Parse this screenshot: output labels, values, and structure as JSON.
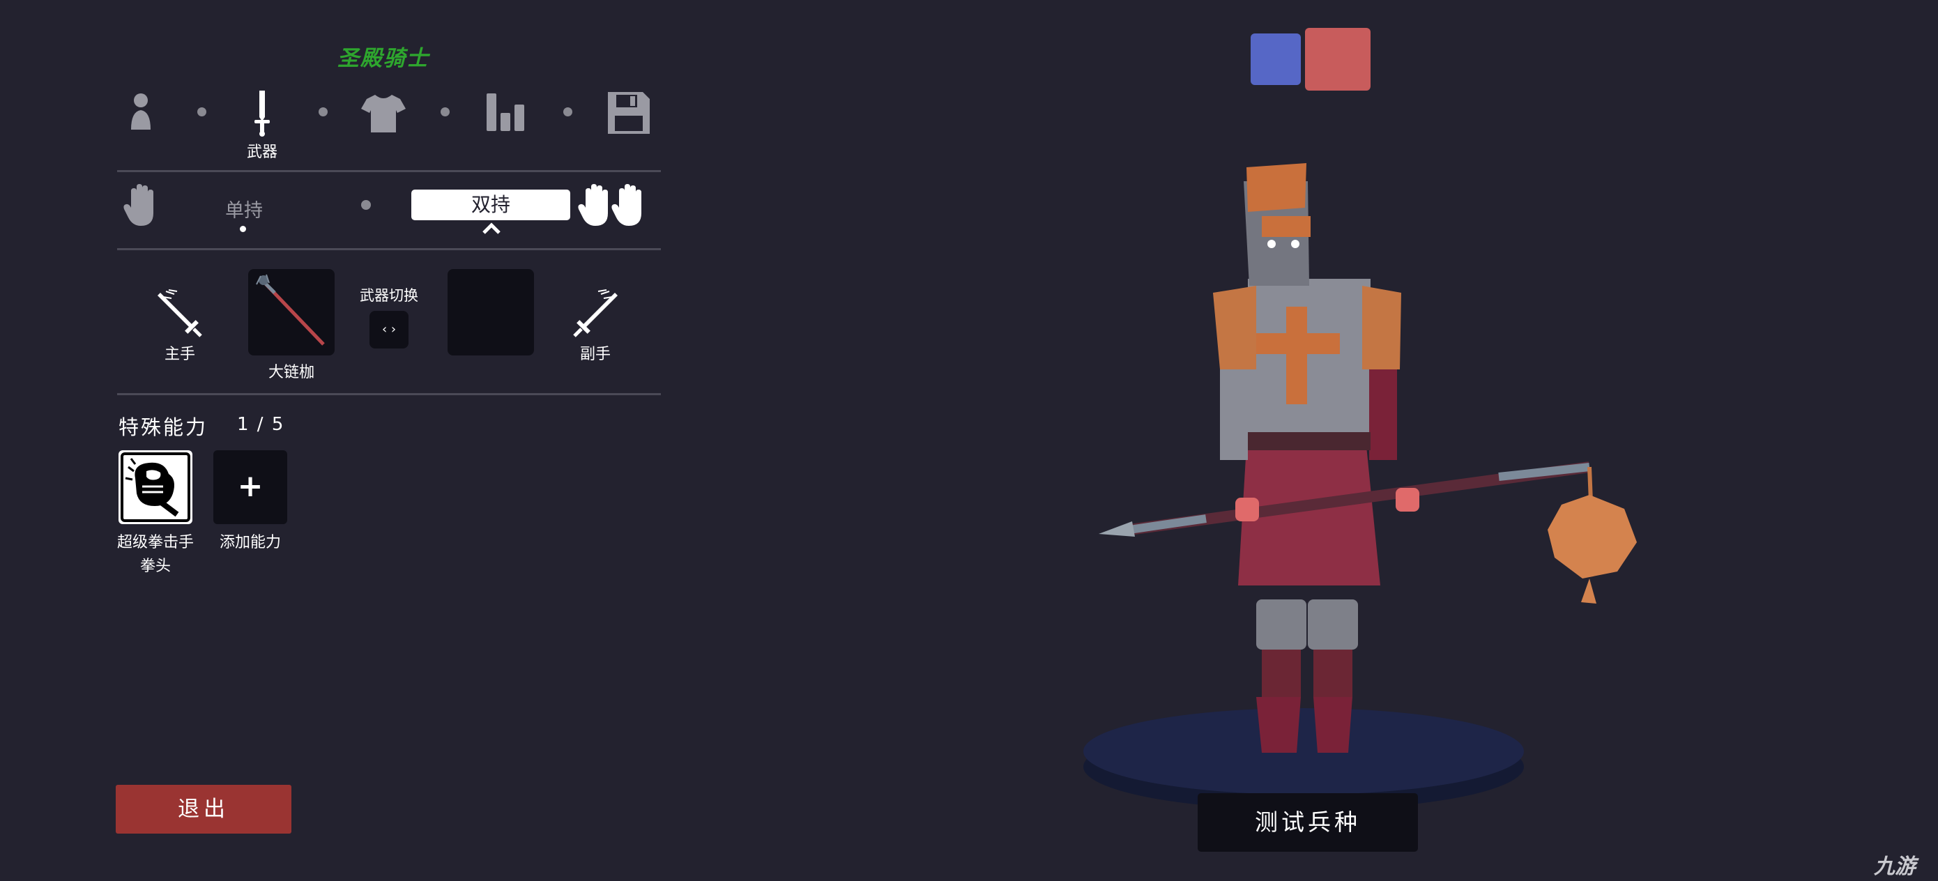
{
  "unit_name": "圣殿骑士",
  "tabs": {
    "unit_icon": "person-icon",
    "weapon_icon": "sword-icon",
    "weapon_label": "武器",
    "clothing_icon": "shirt-icon",
    "stats_icon": "bar-chart-icon",
    "save_icon": "save-disk-icon"
  },
  "grip": {
    "single_label": "单持",
    "dual_label": "双持"
  },
  "weapons": {
    "main_hand_label": "主手",
    "weapon_name": "大链枷",
    "swap_label": "武器切换",
    "swap_icon": "‹ ›",
    "off_hand_label": "副手"
  },
  "abilities": {
    "title": "特殊能力",
    "count": "1 / 5",
    "items": [
      {
        "name_line1": "超级拳击手",
        "name_line2": "拳头"
      }
    ],
    "add_symbol": "+",
    "add_label": "添加能力"
  },
  "team_colors": {
    "blue": "#5667c6",
    "red": "#c85c5c"
  },
  "exit_label": "退出",
  "test_label": "测试兵种",
  "watermark": "九游"
}
